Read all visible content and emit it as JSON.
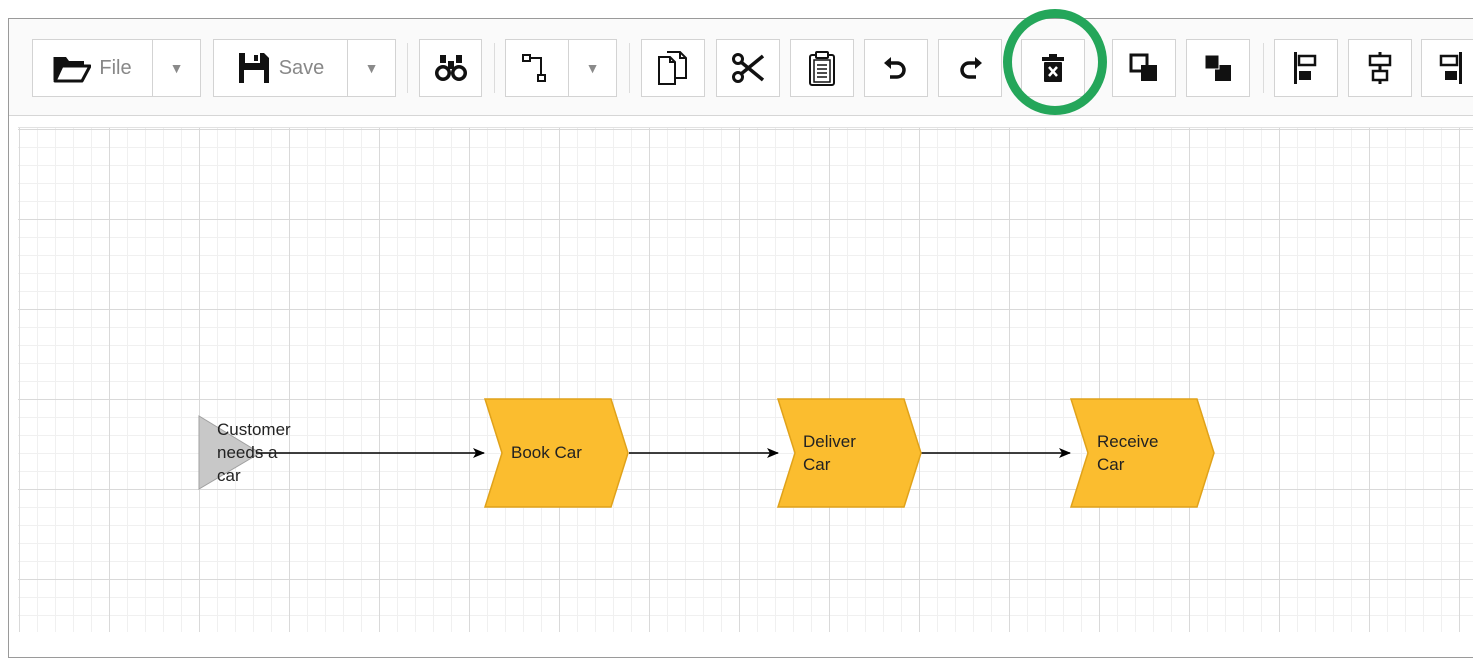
{
  "toolbar": {
    "file_label": "File",
    "save_label": "Save",
    "icons": {
      "file": "folder-open-icon",
      "save": "floppy-disk-icon",
      "find": "binoculars-icon",
      "connector": "connector-icon",
      "copy": "copy-icon",
      "cut": "scissors-icon",
      "paste": "clipboard-icon",
      "undo": "undo-icon",
      "redo": "redo-icon",
      "delete": "trash-icon",
      "bring_front": "bring-to-front-icon",
      "send_back": "send-to-back-icon",
      "align_left": "align-left-icon",
      "align_center": "align-center-icon",
      "align_right": "align-right-icon"
    },
    "highlighted_button": "delete",
    "highlight_color": "#24a65a"
  },
  "diagram": {
    "event": {
      "label_lines": [
        "Customer",
        "needs a",
        "car"
      ],
      "fill": "#c8c8c8"
    },
    "functions": [
      {
        "label_lines": [
          "Book Car"
        ]
      },
      {
        "label_lines": [
          "Deliver",
          "Car"
        ]
      },
      {
        "label_lines": [
          "Receive",
          "Car"
        ]
      }
    ],
    "function_fill": "#fbbd2f",
    "function_stroke": "#e0a21a",
    "connector_color": "#000000"
  }
}
